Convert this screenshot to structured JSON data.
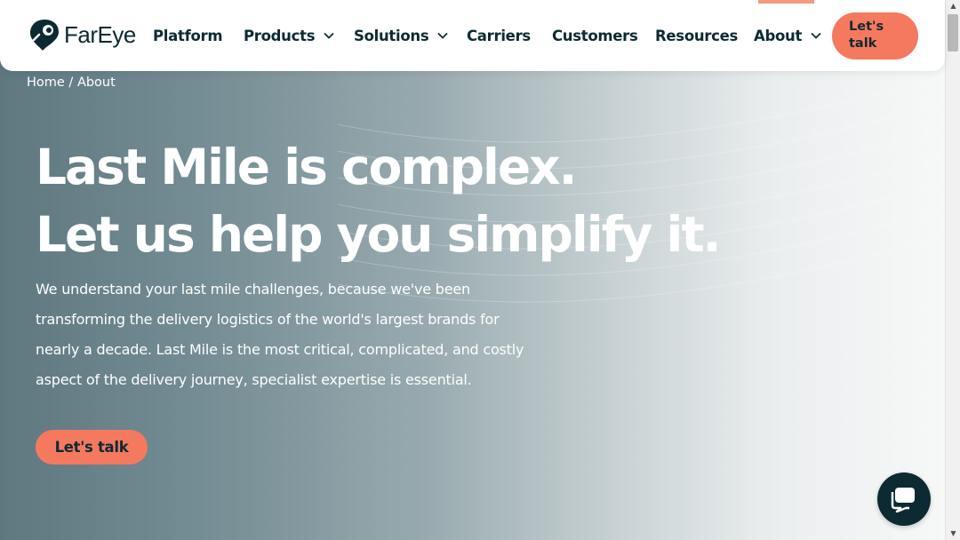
{
  "brand": {
    "name": "FarEye",
    "logo_icon": "fareye-pin-logo-icon",
    "accent": "#f5795f",
    "dark": "#0d2a33"
  },
  "nav": {
    "platform": "Platform",
    "products": "Products",
    "solutions": "Solutions",
    "carriers": "Carriers",
    "customers": "Customers",
    "resources": "Resources",
    "about": "About",
    "talk_line1": "Let's",
    "talk_line2": "talk"
  },
  "breadcrumb": {
    "home": "Home",
    "separator": " / ",
    "current": "About"
  },
  "hero": {
    "headline_line1": "Last Mile is complex.",
    "headline_line2": "Let us help you simplify it.",
    "paragraph": "We understand your last mile challenges, because we've been transforming the delivery logistics of the world's largest brands for nearly a decade. Last Mile is the most critical, complicated, and costly aspect of the delivery journey, specialist expertise is essential.",
    "cta_label": "Let's talk"
  },
  "chat": {
    "icon": "chat-bubble-icon"
  }
}
